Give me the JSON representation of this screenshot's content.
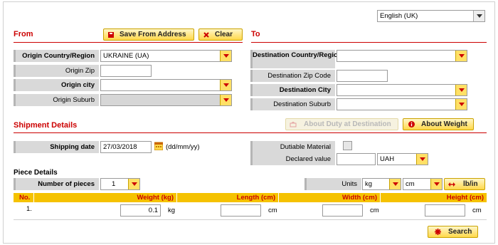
{
  "language": {
    "selected": "English (UK)"
  },
  "from": {
    "title": "From",
    "save_button": "Save From Address",
    "clear_button": "Clear",
    "country_label": "Origin Country/Region",
    "country_value": "UKRAINE (UA)",
    "zip_label": "Origin Zip",
    "zip_value": "",
    "city_label": "Origin city",
    "city_value": "",
    "suburb_label": "Origin Suburb",
    "suburb_value": ""
  },
  "to": {
    "title": "To",
    "country_label": "Destination Country/Region",
    "country_value": "",
    "zip_label": "Destination Zip Code",
    "zip_value": "",
    "city_label": "Destination City",
    "city_value": "",
    "suburb_label": "Destination Suburb",
    "suburb_value": ""
  },
  "shipment": {
    "title": "Shipment Details",
    "duty_button": "About Duty at Destination",
    "weight_button": "About Weight",
    "date_label": "Shipping date",
    "date_value": "27/03/2018",
    "date_format": "(dd/mm/yy)",
    "dutiable_label": "Dutiable Material",
    "declared_label": "Declared value",
    "declared_value": "",
    "currency": "UAH"
  },
  "pieces": {
    "title": "Piece Details",
    "count_label": "Number of pieces",
    "count_value": "1",
    "units_label": "Units",
    "weight_unit": "kg",
    "length_unit": "cm",
    "toggle_button": "lb/in",
    "columns": [
      "No.",
      "Weight (kg)",
      "Length (cm)",
      "Width (cm)",
      "Height (cm)"
    ],
    "rows": [
      {
        "no": "1.",
        "weight": "0.1",
        "weight_unit": "kg",
        "length": "",
        "length_unit": "cm",
        "width": "",
        "width_unit": "cm",
        "height": "",
        "height_unit": "cm"
      }
    ]
  },
  "search_button": "Search",
  "colors": {
    "accent": "#cc0000",
    "button": "#ffd84a",
    "header": "#f5c200"
  }
}
